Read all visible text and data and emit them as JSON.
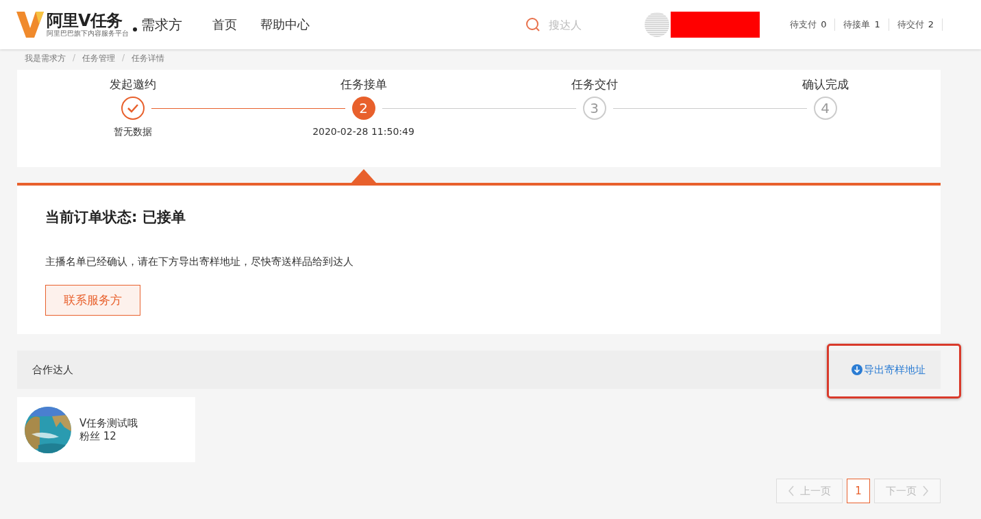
{
  "header": {
    "logo": {
      "brand": "阿里V任务",
      "tagline": "阿里巴巴旗下内容服务平台"
    },
    "role": "需求方",
    "nav": [
      {
        "label": "首页"
      },
      {
        "label": "帮助中心"
      }
    ],
    "search": {
      "placeholder": "搜达人"
    },
    "counters": [
      {
        "label": "待支付",
        "count": "0"
      },
      {
        "label": "待接单",
        "count": "1"
      },
      {
        "label": "待交付",
        "count": "2"
      }
    ]
  },
  "breadcrumb": [
    {
      "kind": "link",
      "text": "我是需求方"
    },
    {
      "kind": "separator",
      "text": "/"
    },
    {
      "kind": "link",
      "text": "任务管理"
    },
    {
      "kind": "separator",
      "text": "/"
    },
    {
      "kind": "link",
      "text": "任务详情"
    }
  ],
  "steps": [
    {
      "label": "发起邀约",
      "kind": "done",
      "note": "暂无数据"
    },
    {
      "label": "任务接单",
      "kind": "current",
      "number": "2",
      "note": "2020-02-28 11:50:49"
    },
    {
      "label": "任务交付",
      "kind": "pending",
      "number": "3"
    },
    {
      "label": "确认完成",
      "kind": "pending",
      "number": "4"
    }
  ],
  "order_status": {
    "title": "当前订单状态: 已接单",
    "message": "主播名单已经确认，请在下方导出寄样地址，尽快寄送样品给到达人",
    "button": "联系服务方"
  },
  "partners": {
    "title": "合作达人",
    "export_link": "导出寄样地址",
    "highlighted": true,
    "items": [
      {
        "name": "V任务测试哦",
        "fans": "粉丝 12"
      }
    ]
  },
  "pagination": {
    "prev": {
      "label": "上一页",
      "disabled": true
    },
    "pages": [
      {
        "label": "1",
        "selected": true
      }
    ],
    "next": {
      "label": "下一页",
      "disabled": true
    }
  }
}
